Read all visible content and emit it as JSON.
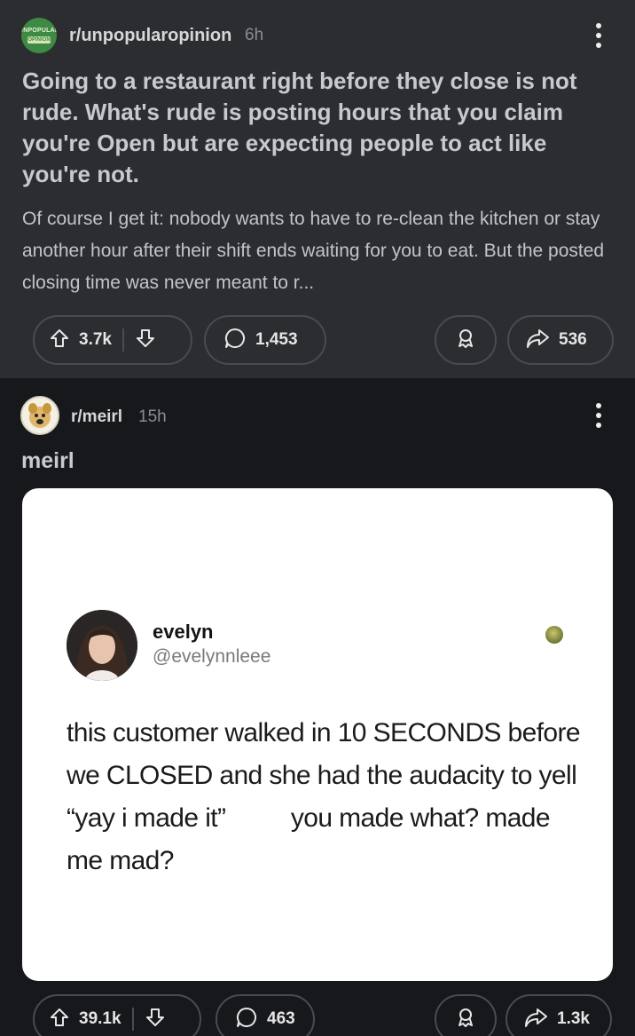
{
  "post1": {
    "subreddit": "r/unpopularopinion",
    "age": "6h",
    "avatar_text_top": "UNPOPULAR",
    "avatar_text_bottom": "OPINION",
    "title": "Going to a restaurant right before they close is not rude. What's rude is posting hours that you claim you're Open but are expecting people to act like you're not.",
    "body": "Of course I get it: nobody wants to have to re-clean the kitchen or stay another hour after their shift ends waiting for you to eat. But the posted closing time was never meant to r...",
    "votes": "3.7k",
    "comments": "1,453",
    "shares": "536"
  },
  "post2": {
    "subreddit": "r/meirl",
    "age": "15h",
    "title": "meirl",
    "tweet": {
      "name": "evelyn",
      "handle": "@evelynnleee",
      "text_before": "this customer walked in 10 SECONDS before we CLOSED and she had the audacity to yell “yay i made it” ",
      "text_after": " you made what? made me mad?"
    },
    "votes": "39.1k",
    "comments": "463",
    "shares": "1.3k"
  },
  "icons": [
    "upvote-icon",
    "downvote-icon",
    "comment-icon",
    "award-icon",
    "share-icon",
    "more-options-icon"
  ],
  "colors": {
    "post_bg": "#2c2d30",
    "page_bg": "#17181b",
    "card_bg": "#ffffff"
  }
}
